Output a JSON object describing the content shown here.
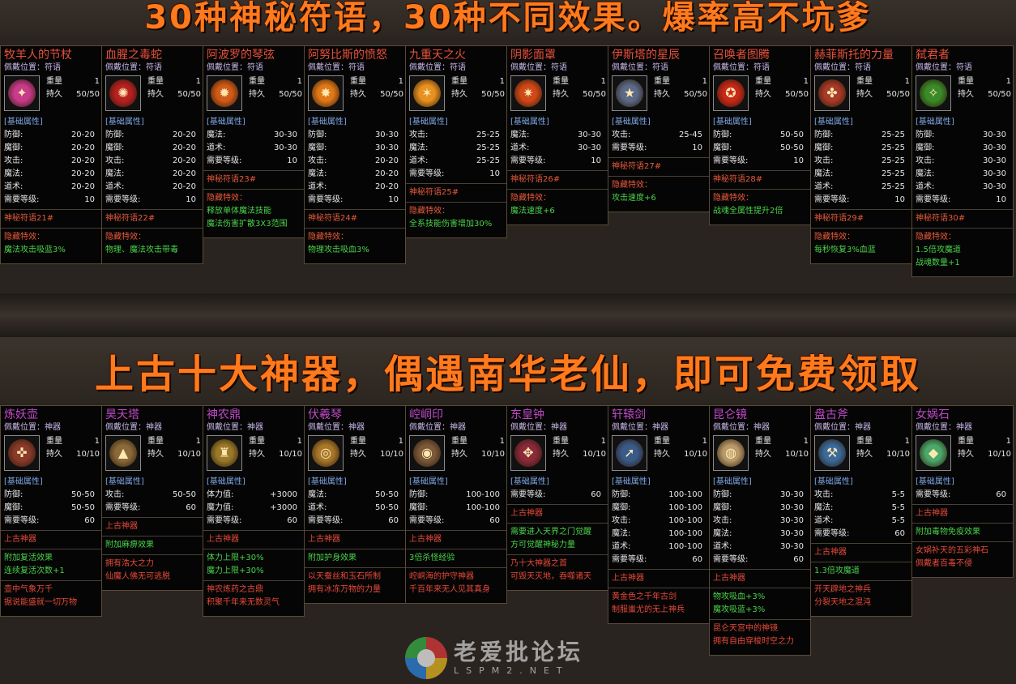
{
  "banners": {
    "top": "30种神秘符语，30种不同效果。爆率高不坑爹",
    "middle": "上古十大神器，偶遇南华老仙，即可免费领取"
  },
  "labels": {
    "slot_prefix": "佩戴位置：",
    "weight": "重量",
    "durability": "持久",
    "base_section": "[基础属性]",
    "hidden": "隐藏特效："
  },
  "row1": [
    {
      "name": "牧羊人的节杖",
      "slot": "符语",
      "weight": "1",
      "dur": "50/50",
      "icon": "staff-icon",
      "color": "#c83a8a",
      "attrs": [
        [
          "防御:",
          "20-20"
        ],
        [
          "魔御:",
          "20-20"
        ],
        [
          "攻击:",
          "20-20"
        ],
        [
          "魔法:",
          "20-20"
        ],
        [
          "道术:",
          "20-20"
        ],
        [
          "需要等级:",
          "10"
        ]
      ],
      "sigil": "神秘符语21#",
      "effects": [
        "魔法攻击吸蓝3%"
      ]
    },
    {
      "name": "血腥之毒蛇",
      "slot": "符语",
      "weight": "1",
      "dur": "50/50",
      "icon": "snake-icon",
      "color": "#b82020",
      "attrs": [
        [
          "防御:",
          "20-20"
        ],
        [
          "魔御:",
          "20-20"
        ],
        [
          "攻击:",
          "20-20"
        ],
        [
          "魔法:",
          "20-20"
        ],
        [
          "道术:",
          "20-20"
        ],
        [
          "需要等级:",
          "10"
        ]
      ],
      "sigil": "神秘符语22#",
      "effects": [
        "物理、魔法攻击带毒"
      ]
    },
    {
      "name": "阿波罗的琴弦",
      "slot": "符语",
      "weight": "1",
      "dur": "50/50",
      "icon": "lyre-icon",
      "color": "#d05a18",
      "attrs": [
        [
          "魔法:",
          "30-30"
        ],
        [
          "道术:",
          "30-30"
        ],
        [
          "需要等级:",
          "10"
        ]
      ],
      "sigil": "神秘符语23#",
      "effects": [
        "释放单体魔法技能",
        "魔法伤害扩散3X3范围"
      ]
    },
    {
      "name": "阿努比斯的愤怒",
      "slot": "符语",
      "weight": "1",
      "dur": "50/50",
      "icon": "anubis-icon",
      "color": "#e07818",
      "attrs": [
        [
          "防御:",
          "30-30"
        ],
        [
          "魔御:",
          "30-30"
        ],
        [
          "攻击:",
          "20-20"
        ],
        [
          "魔法:",
          "20-20"
        ],
        [
          "道术:",
          "20-20"
        ],
        [
          "需要等级:",
          "10"
        ]
      ],
      "sigil": "神秘符语24#",
      "effects": [
        "物理攻击吸血3%"
      ]
    },
    {
      "name": "九重天之火",
      "slot": "符语",
      "weight": "1",
      "dur": "50/50",
      "icon": "fire-icon",
      "color": "#e89020",
      "attrs": [
        [
          "攻击:",
          "25-25"
        ],
        [
          "魔法:",
          "25-25"
        ],
        [
          "道术:",
          "25-25"
        ],
        [
          "需要等级:",
          "10"
        ]
      ],
      "sigil": "神秘符语25#",
      "effects": [
        "全系技能伤害增加30%"
      ]
    },
    {
      "name": "阴影面罩",
      "slot": "符语",
      "weight": "1",
      "dur": "50/50",
      "icon": "mask-icon",
      "color": "#d04818",
      "attrs": [
        [
          "魔法:",
          "30-30"
        ],
        [
          "道术:",
          "30-30"
        ],
        [
          "需要等级:",
          "10"
        ]
      ],
      "sigil": "神秘符语26#",
      "effects": [
        "魔法速度+6"
      ]
    },
    {
      "name": "伊斯塔的星辰",
      "slot": "符语",
      "weight": "1",
      "dur": "50/50",
      "icon": "star-icon",
      "color": "#5a6a88",
      "attrs": [
        [
          "攻击:",
          "25-45"
        ],
        [
          "需要等级:",
          "10"
        ]
      ],
      "sigil": "神秘符语27#",
      "effects": [
        "攻击速度+6"
      ]
    },
    {
      "name": "召唤者图腾",
      "slot": "符语",
      "weight": "1",
      "dur": "50/50",
      "icon": "totem-icon",
      "color": "#c82818",
      "attrs": [
        [
          "防御:",
          "50-50"
        ],
        [
          "魔御:",
          "50-50"
        ],
        [
          "需要等级:",
          "10"
        ]
      ],
      "sigil": "神秘符语28#",
      "effects": [
        "战魂全属性提升2倍"
      ]
    },
    {
      "name": "赫菲斯托的力量",
      "slot": "符语",
      "weight": "1",
      "dur": "50/50",
      "icon": "hammer-icon",
      "color": "#a83a28",
      "attrs": [
        [
          "防御:",
          "25-25"
        ],
        [
          "魔御:",
          "25-25"
        ],
        [
          "攻击:",
          "25-25"
        ],
        [
          "魔法:",
          "25-25"
        ],
        [
          "道术:",
          "25-25"
        ],
        [
          "需要等级:",
          "10"
        ]
      ],
      "sigil": "神秘符语29#",
      "effects": [
        "每秒恢复3%血蓝"
      ]
    },
    {
      "name": "弑君者",
      "slot": "符语",
      "weight": "1",
      "dur": "50/50",
      "icon": "assassin-icon",
      "color": "#3a8a28",
      "attrs": [
        [
          "防御:",
          "30-30"
        ],
        [
          "魔御:",
          "30-30"
        ],
        [
          "攻击:",
          "30-30"
        ],
        [
          "魔法:",
          "30-30"
        ],
        [
          "道术:",
          "30-30"
        ],
        [
          "需要等级:",
          "10"
        ]
      ],
      "sigil": "神秘符语30#",
      "effects": [
        "1.5倍攻魔道",
        "战魂数量+1"
      ]
    }
  ],
  "row2": [
    {
      "name": "炼妖壶",
      "slot": "神器",
      "weight": "1",
      "dur": "10/10",
      "icon": "gourd-icon",
      "color": "#8a3a2a",
      "attrs": [
        [
          "防御:",
          "50-50"
        ],
        [
          "魔御:",
          "50-50"
        ],
        [
          "需要等级:",
          "60"
        ]
      ],
      "type": "上古神器",
      "effects": [
        "附加复活效果",
        "连续复活次数+1"
      ],
      "lore": [
        "壶中气象万千",
        "据说能盛就一切万物"
      ]
    },
    {
      "name": "昊天塔",
      "slot": "神器",
      "weight": "1",
      "dur": "10/10",
      "icon": "tower-icon",
      "color": "#8a6a3a",
      "attrs": [
        [
          "攻击:",
          "50-50"
        ],
        [
          "需要等级:",
          "60"
        ]
      ],
      "type": "上古神器",
      "effects": [
        "附加麻痹效果"
      ],
      "lore": [
        "拥有浩大之力",
        "仙魔人佛无可逃脱"
      ]
    },
    {
      "name": "神农鼎",
      "slot": "神器",
      "weight": "1",
      "dur": "10/10",
      "icon": "cauldron-icon",
      "color": "#9a7a2a",
      "attrs": [
        [
          "体力值:",
          "+3000"
        ],
        [
          "魔力值:",
          "+3000"
        ],
        [
          "需要等级:",
          "60"
        ]
      ],
      "type": "上古神器",
      "effects": [
        "体力上限+30%",
        "魔力上限+30%"
      ],
      "lore": [
        "神农炼药之古鼎",
        "积聚千年来无数灵气"
      ]
    },
    {
      "name": "伏羲琴",
      "slot": "神器",
      "weight": "1",
      "dur": "10/10",
      "icon": "ring-icon",
      "color": "#a8782a",
      "attrs": [
        [
          "魔法:",
          "50-50"
        ],
        [
          "道术:",
          "50-50"
        ],
        [
          "需要等级:",
          "60"
        ]
      ],
      "type": "上古神器",
      "effects": [
        "附加护身效果"
      ],
      "lore": [
        "以天蚕丝和玉石所制",
        "拥有冰冻万物的力量"
      ]
    },
    {
      "name": "崆峒印",
      "slot": "神器",
      "weight": "1",
      "dur": "10/10",
      "icon": "seal-icon",
      "color": "#7a5a3a",
      "attrs": [
        [
          "防御:",
          "100-100"
        ],
        [
          "魔御:",
          "100-100"
        ],
        [
          "需要等级:",
          "60"
        ]
      ],
      "type": "上古神器",
      "effects": [
        "3倍杀怪经验"
      ],
      "lore": [
        "崆峒海的护守神器",
        "千百年来无人见其真身"
      ]
    },
    {
      "name": "东皇钟",
      "slot": "神器",
      "weight": "1",
      "dur": "10/10",
      "icon": "bell-icon",
      "color": "#8a2a3a",
      "attrs": [
        [
          "需要等级:",
          "60"
        ]
      ],
      "type": "上古神器",
      "effects": [
        "需要进入天界之门觉醒",
        "方可觉醒神秘力量"
      ],
      "lore": [
        "乃十大神器之首",
        "可毁天灭地，吞噬诸天"
      ]
    },
    {
      "name": "轩辕剑",
      "slot": "神器",
      "weight": "1",
      "dur": "10/10",
      "icon": "sword-icon",
      "color": "#3a5a8a",
      "attrs": [
        [
          "防御:",
          "100-100"
        ],
        [
          "魔御:",
          "100-100"
        ],
        [
          "攻击:",
          "100-100"
        ],
        [
          "魔法:",
          "100-100"
        ],
        [
          "道术:",
          "100-100"
        ],
        [
          "需要等级:",
          "60"
        ]
      ],
      "type": "上古神器",
      "effects": [],
      "lore": [
        "黄金色之千年古剑",
        "制服蚩尤的无上神兵"
      ]
    },
    {
      "name": "昆仑镜",
      "slot": "神器",
      "weight": "1",
      "dur": "10/10",
      "icon": "mirror-icon",
      "color": "#b89a6a",
      "attrs": [
        [
          "防御:",
          "30-30"
        ],
        [
          "魔御:",
          "30-30"
        ],
        [
          "攻击:",
          "30-30"
        ],
        [
          "魔法:",
          "30-30"
        ],
        [
          "道术:",
          "30-30"
        ],
        [
          "需要等级:",
          "60"
        ]
      ],
      "type": "上古神器",
      "effects": [
        "物攻吸血+3%",
        "魔攻吸蓝+3%"
      ],
      "lore": [
        "昆仑天宫中的神镜",
        "拥有自由穿梭时空之力"
      ]
    },
    {
      "name": "盘古斧",
      "slot": "神器",
      "weight": "1",
      "dur": "10/10",
      "icon": "axe-icon",
      "color": "#3a6a9a",
      "attrs": [
        [
          "攻击:",
          "5-5"
        ],
        [
          "魔法:",
          "5-5"
        ],
        [
          "道术:",
          "5-5"
        ],
        [
          "需要等级:",
          "60"
        ]
      ],
      "type": "上古神器",
      "effects": [
        "1.3倍攻魔道"
      ],
      "lore": [
        "开天辟地之神兵",
        "分裂天地之混沌"
      ]
    },
    {
      "name": "女娲石",
      "slot": "神器",
      "weight": "1",
      "dur": "10/10",
      "icon": "stone-icon",
      "color": "#4aa86a",
      "attrs": [
        [
          "需要等级:",
          "60"
        ]
      ],
      "type": "上古神器",
      "effects": [
        "附加毒物免疫效果"
      ],
      "lore": [
        "女娲补天的五彩神石",
        "佩戴者百毒不侵"
      ]
    }
  ],
  "watermark": {
    "cn": "老爱批论坛",
    "en": "LSPM2.NET"
  }
}
